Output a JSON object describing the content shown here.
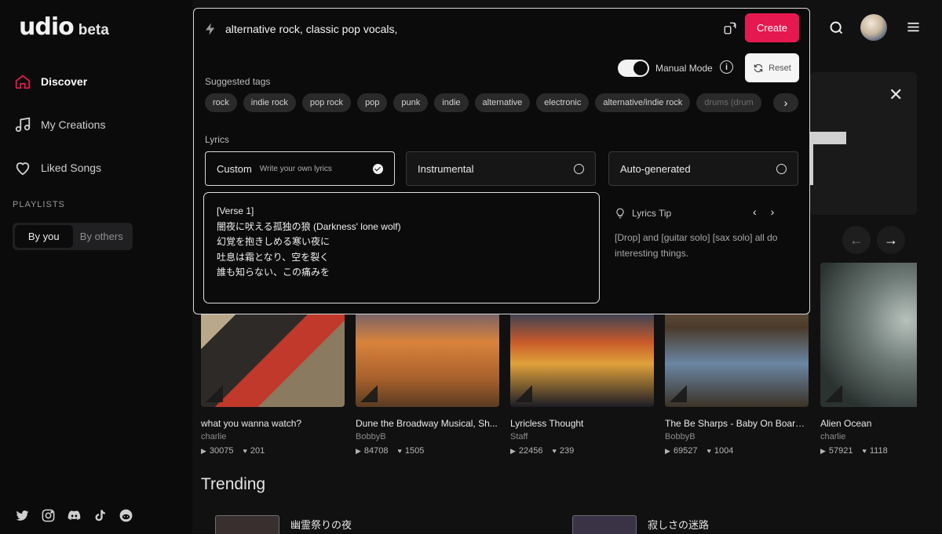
{
  "app": {
    "logo": "udio",
    "logo_suffix": "beta"
  },
  "sidebar": {
    "items": [
      {
        "label": "Discover",
        "icon": "home-icon",
        "active": true
      },
      {
        "label": "My Creations",
        "icon": "music-note-icon",
        "active": false
      },
      {
        "label": "Liked Songs",
        "icon": "heart-icon",
        "active": false
      }
    ],
    "playlists_heading": "PLAYLISTS",
    "playlist_tabs": [
      "By you",
      "By others"
    ],
    "playlist_selected": "By you",
    "socials": [
      "twitter-icon",
      "instagram-icon",
      "discord-icon",
      "tiktok-icon",
      "reddit-icon"
    ]
  },
  "topbar": {
    "search_icon": "search-icon",
    "avatar": "avatar",
    "menu_icon": "hamburger-menu-icon"
  },
  "create_panel": {
    "prompt_value": "alternative rock, classic pop vocals,",
    "create_label": "Create",
    "manual_mode_label": "Manual Mode",
    "manual_mode_on": true,
    "reset_label": "Reset",
    "suggested_tags_heading": "Suggested tags",
    "tags": [
      "rock",
      "indie rock",
      "pop rock",
      "pop",
      "punk",
      "indie",
      "alternative",
      "electronic",
      "alternative/indie rock",
      "drums (drum"
    ],
    "lyrics_heading": "Lyrics",
    "lyric_options": [
      {
        "label": "Custom",
        "sub": "Write your own lyrics",
        "selected": true
      },
      {
        "label": "Instrumental",
        "sub": "",
        "selected": false
      },
      {
        "label": "Auto-generated",
        "sub": "",
        "selected": false
      }
    ],
    "lyrics_text": "[Verse 1]\n闇夜に吠える孤独の狼 (Darkness' lone wolf)\n幻覚を抱きしめる寒い夜に\n吐息は霜となり、空を裂く\n誰も知らない、この痛みを",
    "tip_heading": "Lyrics Tip",
    "tip_body": "[Drop] and [guitar solo] [sax solo] all do interesting things."
  },
  "songs": [
    {
      "title": "what you wanna watch?",
      "artist": "charlie",
      "plays": "30075",
      "likes": "201",
      "colors": [
        "#b9a88a",
        "#2d2a28",
        "#c0392b"
      ]
    },
    {
      "title": "Dune the Broadway Musical, Sh...",
      "artist": "BobbyB",
      "plays": "84708",
      "likes": "1505",
      "colors": [
        "#d9833c",
        "#5a3b22",
        "#2e3f63"
      ]
    },
    {
      "title": "Lyricless Thought",
      "artist": "Staff",
      "plays": "22456",
      "likes": "239",
      "colors": [
        "#4c5a78",
        "#c85a2a",
        "#1c1c25"
      ]
    },
    {
      "title": "The Be Sharps - Baby On Board,...",
      "artist": "BobbyB",
      "plays": "69527",
      "likes": "1004",
      "colors": [
        "#8f7e62",
        "#4b3a2a",
        "#6a86a3"
      ]
    },
    {
      "title": "Alien Ocean",
      "artist": "charlie",
      "plays": "57921",
      "likes": "1118",
      "colors": [
        "#6f7c78",
        "#2b3331",
        "#b8c2bd"
      ]
    }
  ],
  "trending": {
    "heading": "Trending",
    "items": [
      {
        "title": "幽霊祭りの夜"
      },
      {
        "title": "寂しさの迷路"
      }
    ]
  }
}
